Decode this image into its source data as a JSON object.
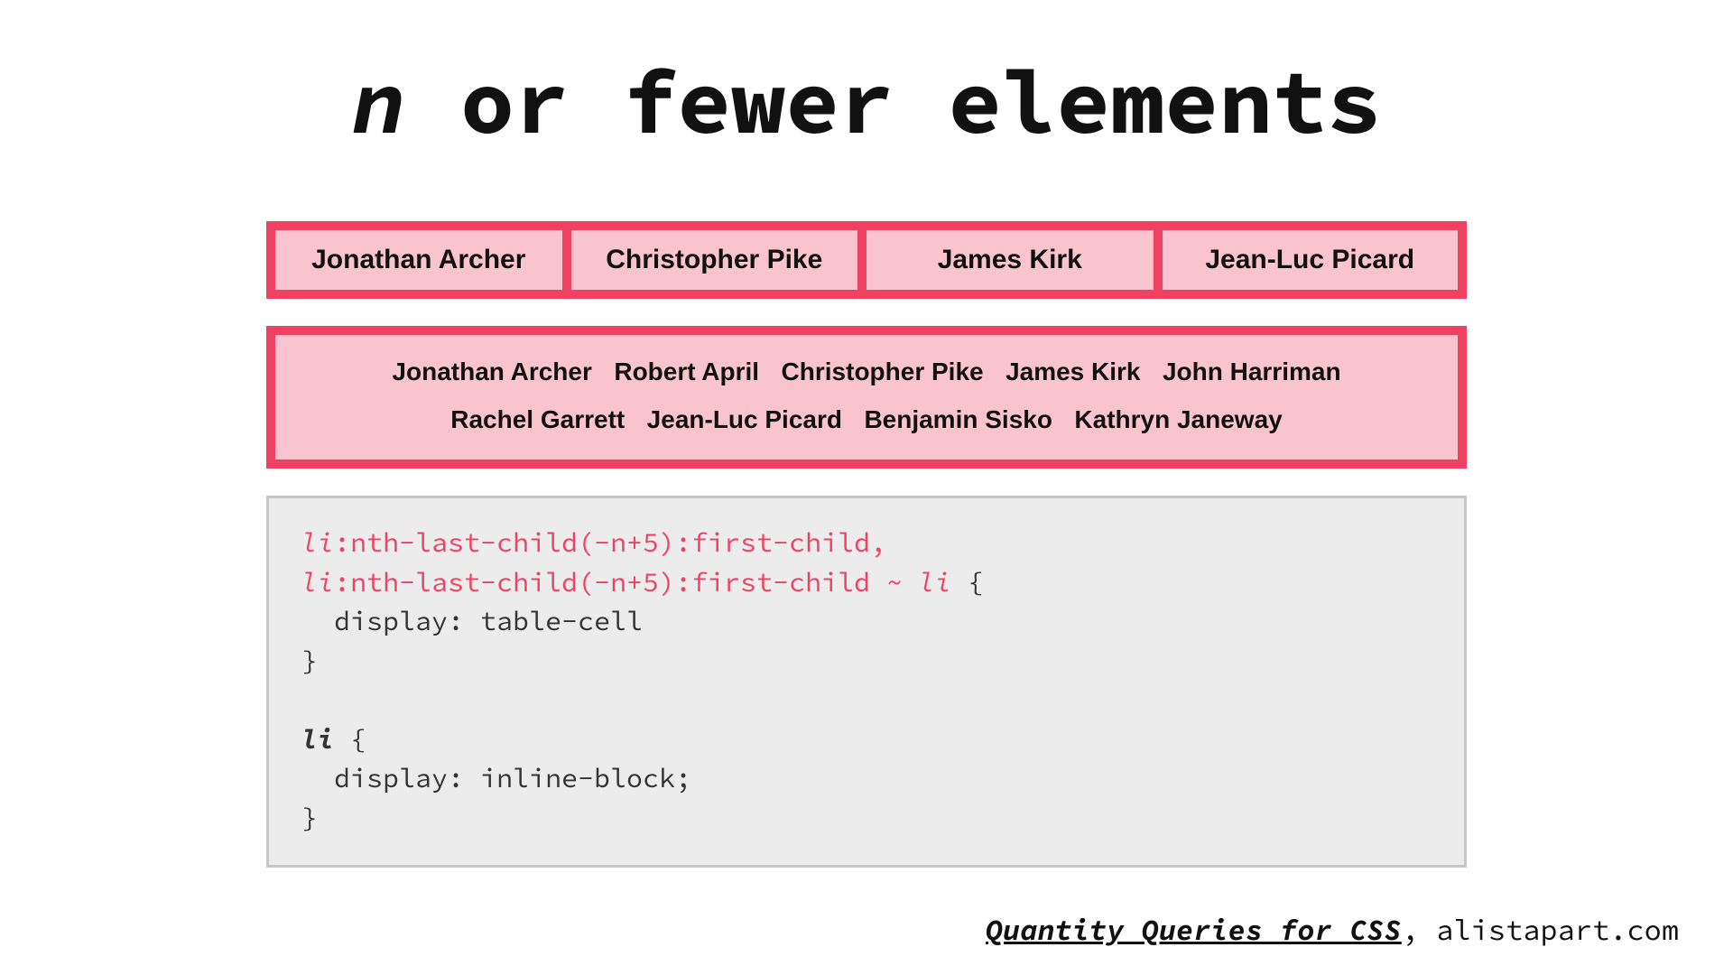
{
  "title": {
    "n": "n",
    "rest": " or fewer elements"
  },
  "box1": [
    "Jonathan Archer",
    "Christopher Pike",
    "James Kirk",
    "Jean-Luc Picard"
  ],
  "box2": [
    "Jonathan Archer",
    "Robert April",
    "Christopher Pike",
    "James Kirk",
    "John Harriman",
    "Rachel Garrett",
    "Jean-Luc Picard",
    "Benjamin Sisko",
    "Kathryn Janeway"
  ],
  "code": {
    "sel1_tag": "li",
    "sel1_rest": ":nth-last-child(-n+5):first-child,",
    "sel2_tag": "li",
    "sel2_rest1": ":nth-last-child(-n+5):first-child ~ ",
    "sel2_tag2": "li",
    "sel2_rest2": " {",
    "line3": "  display: table-cell",
    "line4": "}",
    "blank": "",
    "line6_tag": "li",
    "line6_rest": " {",
    "line7": "  display: inline-block;",
    "line8": "}"
  },
  "footer": {
    "link": "Quantity Queries for CSS",
    "sep": ", ",
    "src": "alistapart.com"
  }
}
